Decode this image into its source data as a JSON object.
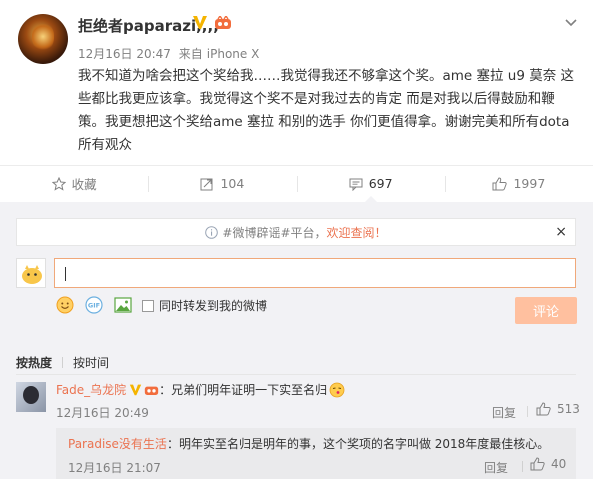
{
  "post": {
    "username": "拒绝者paparazi,,,,",
    "time": "12月16日 20:47",
    "source_prefix": "来自",
    "source": "iPhone X",
    "content": "我不知道为啥会把这个奖给我……我觉得我还不够拿这个奖。ame 塞拉 u9 莫奈 这些都比我更应该拿。我觉得这个奖不是对我过去的肯定 而是对我以后得鼓励和鞭策。我更想把这个奖给ame 塞拉 和别的选手 你们更值得拿。谢谢完美和所有dota所有观众"
  },
  "actions": {
    "favorite_label": "收藏",
    "forward_count": "104",
    "comment_count": "697",
    "like_count": "1997"
  },
  "notice": {
    "prefix": "#微博辟谣#平台，",
    "highlight": "欢迎查阅！",
    "close": "×"
  },
  "composer": {
    "forward_label": "同时转发到我的微博",
    "submit_label": "评论"
  },
  "sort": {
    "hot": "按热度",
    "time": "按时间"
  },
  "comment": {
    "name": "Fade_乌龙院",
    "text": "：兄弟们明年证明一下实至名归",
    "time": "12月16日 20:49",
    "reply_label": "回复",
    "likes": "513"
  },
  "reply": {
    "name": "Paradise没有生活",
    "text": "：明年实至名归是明年的事，这个奖项的名字叫做 2018年度最佳核心。",
    "time": "12月16日 21:07",
    "reply_label": "回复",
    "likes": "40"
  },
  "colors": {
    "accent": "#eb7350",
    "submit_disabled": "#ffc09f",
    "verified": "#f5b400"
  }
}
